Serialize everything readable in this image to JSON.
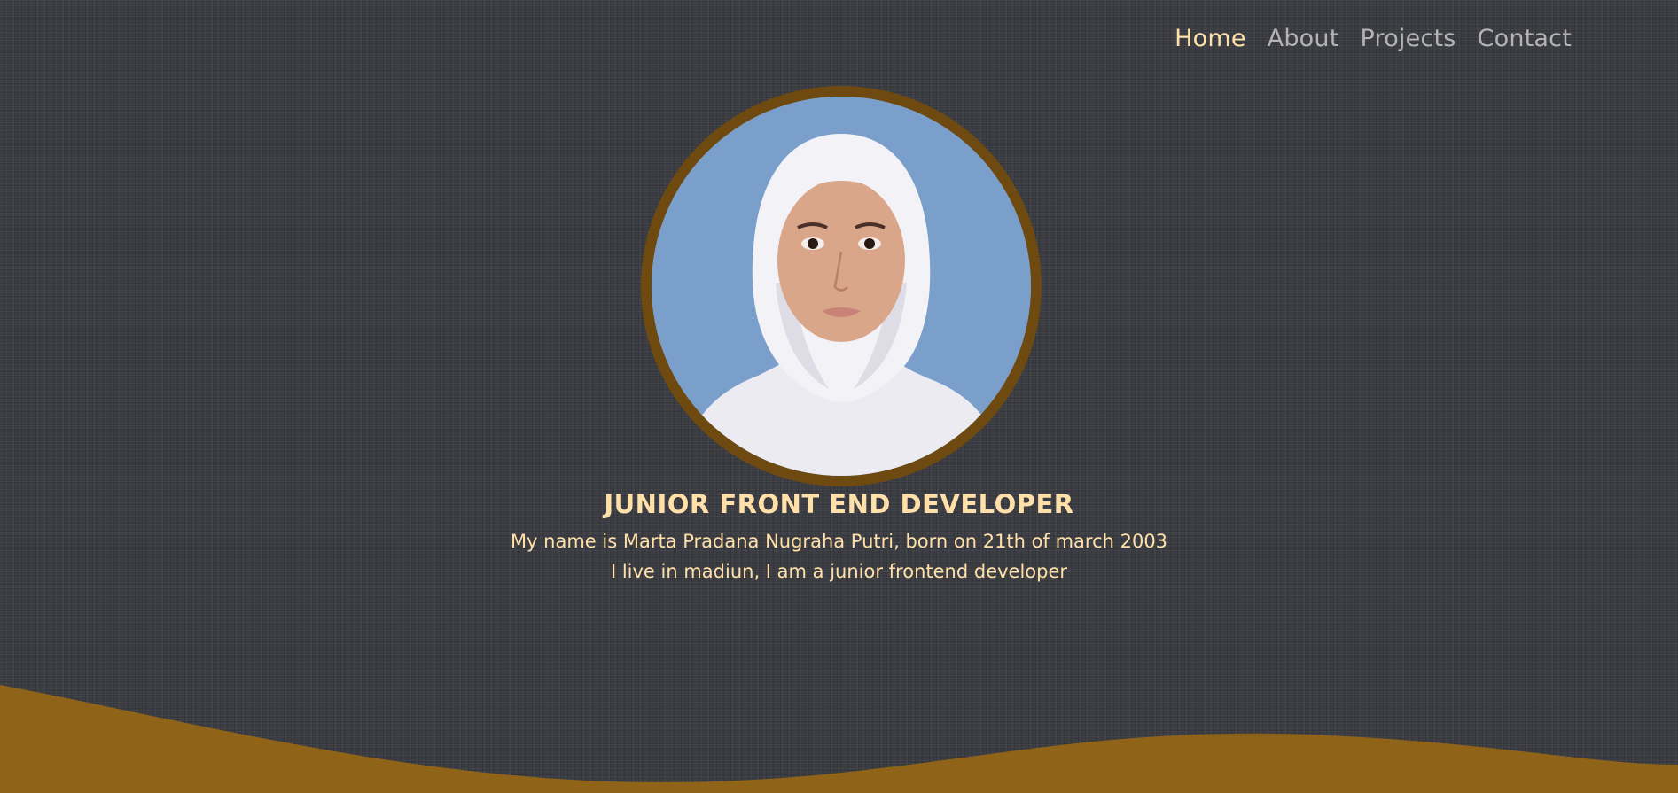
{
  "nav": {
    "items": [
      {
        "label": "Home",
        "active": true
      },
      {
        "label": "About",
        "active": false
      },
      {
        "label": "Projects",
        "active": false
      },
      {
        "label": "Contact",
        "active": false
      }
    ]
  },
  "hero": {
    "title": "JUNIOR FRONT END DEVELOPER",
    "line1": "My name is Marta Pradana Nugraha Putri, born on 21th of march 2003",
    "line2": "I live in madiun, I am a junior frontend developer"
  },
  "colors": {
    "background": "#3a3c42",
    "accent": "#ffe0a8",
    "nav_inactive": "#b4b4b4",
    "ring": "#6e4a10",
    "wave": "#8f6418",
    "photo_background": "#7b9fcb"
  }
}
